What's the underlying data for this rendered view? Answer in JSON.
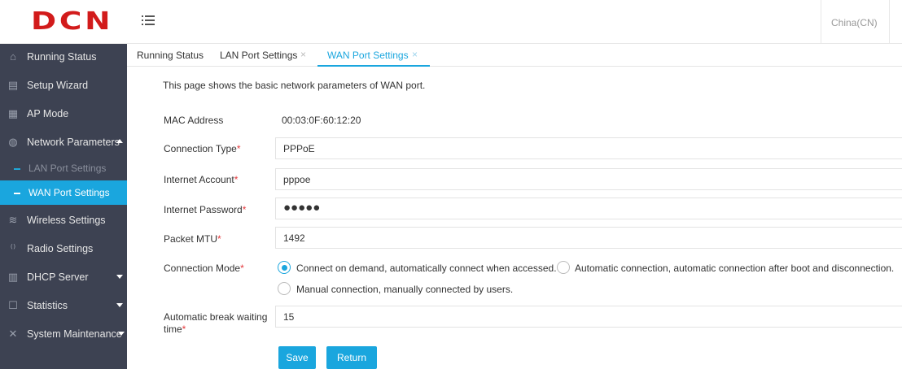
{
  "brand": {
    "logo": "DCN"
  },
  "header": {
    "language": "China(CN)"
  },
  "sidebar": {
    "items": [
      {
        "label": "Running Status",
        "icon": "home-icon"
      },
      {
        "label": "Setup Wizard",
        "icon": "wizard-icon"
      },
      {
        "label": "AP Mode",
        "icon": "ap-mode-icon"
      },
      {
        "label": "Network Parameters",
        "icon": "globe-icon"
      },
      {
        "label": "Wireless Settings",
        "icon": "wifi-icon"
      },
      {
        "label": "Radio Settings",
        "icon": "radio-icon"
      },
      {
        "label": "DHCP Server",
        "icon": "server-icon"
      },
      {
        "label": "Statistics",
        "icon": "chart-icon"
      },
      {
        "label": "System Maintenance",
        "icon": "tools-icon"
      }
    ],
    "subitems": [
      {
        "label": "LAN Port Settings"
      },
      {
        "label": "WAN Port Settings"
      }
    ]
  },
  "tabs": [
    {
      "label": "Running Status"
    },
    {
      "label": "LAN Port Settings",
      "close": "×"
    },
    {
      "label": "WAN Port Settings",
      "close": "×"
    }
  ],
  "form": {
    "description": "This page shows the basic network parameters of WAN port.",
    "required_mark": "*",
    "mac": {
      "label": "MAC Address",
      "value": "00:03:0F:60:12:20"
    },
    "connection_type": {
      "label": "Connection Type",
      "value": "PPPoE"
    },
    "account": {
      "label": "Internet Account",
      "value": "pppoe"
    },
    "password": {
      "label": "Internet Password",
      "value": "●●●●●"
    },
    "mtu": {
      "label": "Packet MTU",
      "value": "1492"
    },
    "mode": {
      "label": "Connection Mode",
      "options": [
        "Connect on demand, automatically connect when accessed.",
        "Automatic connection, automatic connection after boot and disconnection.",
        "Manual connection, manually connected by users."
      ],
      "selected": 0
    },
    "break_time": {
      "label_line1": "Automatic break waiting",
      "label_line2": "time",
      "value": "15"
    }
  },
  "buttons": {
    "save": "Save",
    "return": "Return"
  },
  "colors": {
    "accent": "#1aa6de",
    "sidebar_bg": "#3d4252",
    "logo": "#d21b1b",
    "required": "#e4393c"
  }
}
